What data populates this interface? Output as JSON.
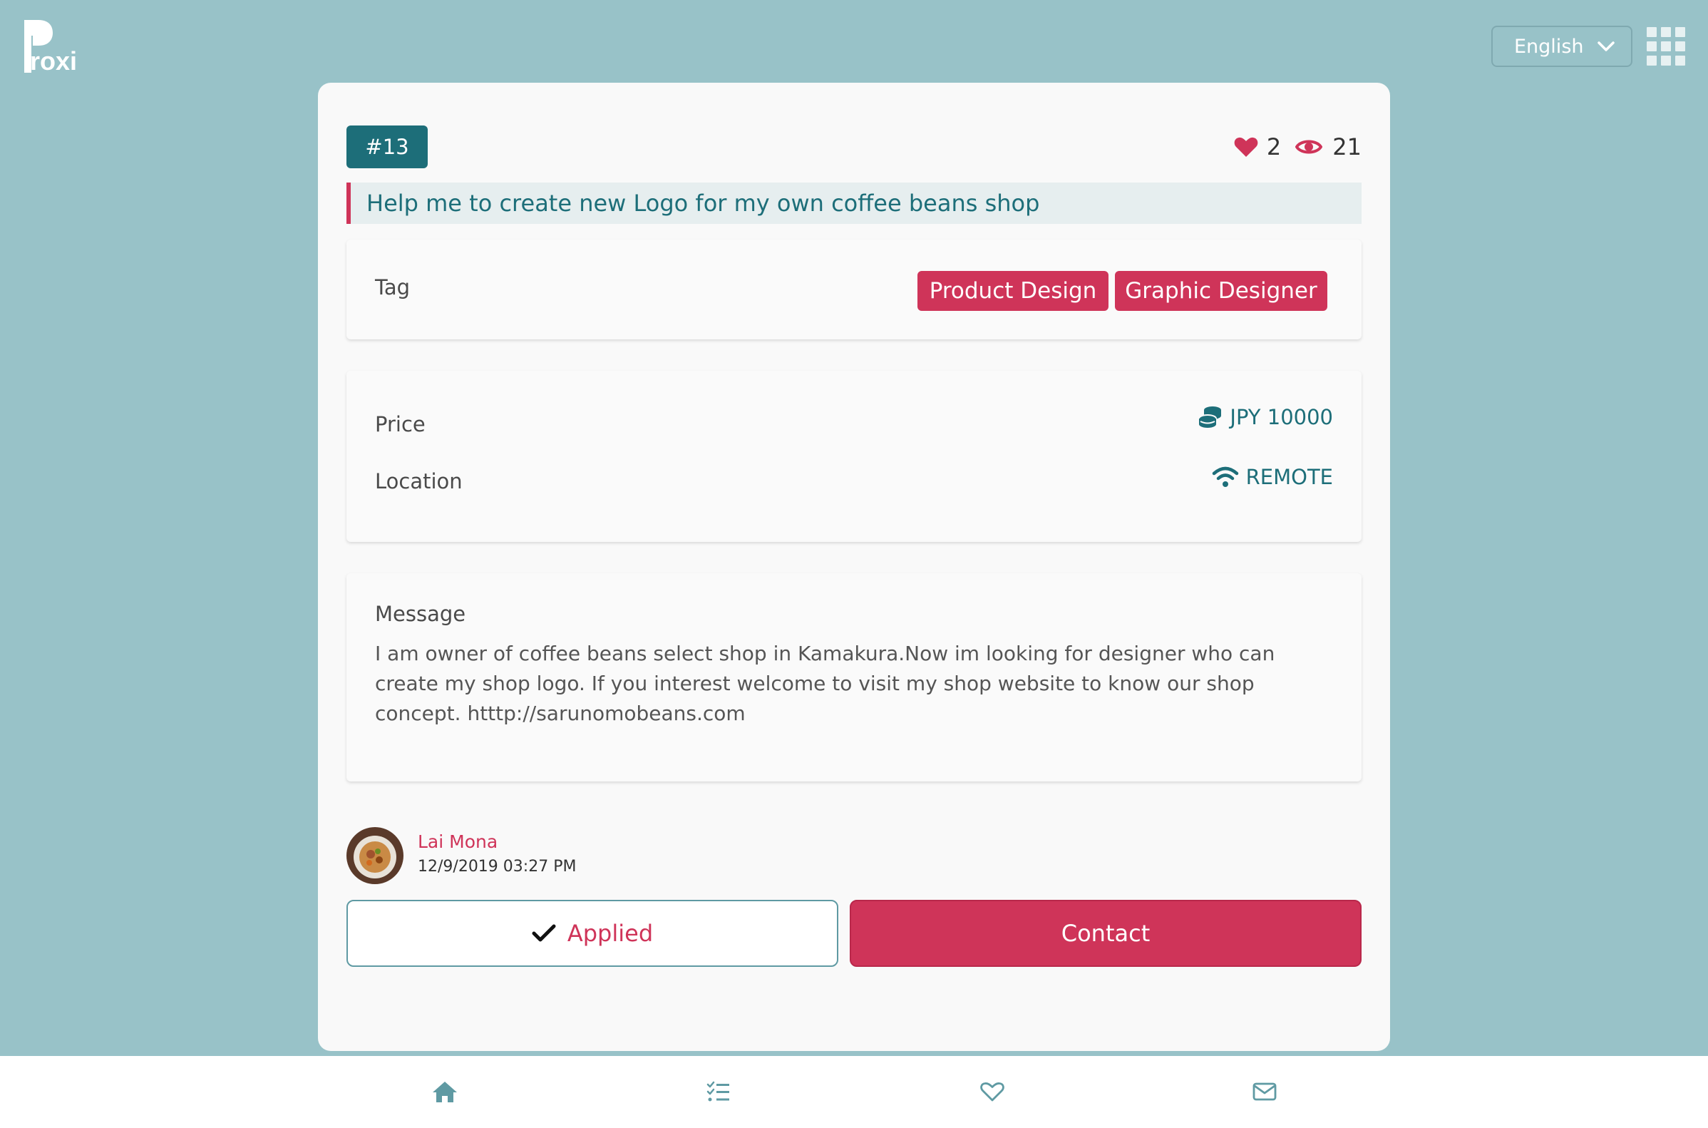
{
  "header": {
    "logo_text": "roxi",
    "language": "English"
  },
  "post": {
    "id_label": "#13",
    "likes": "2",
    "views": "21",
    "title": "Help me to create new Logo for my own coffee beans shop",
    "tag_label": "Tag",
    "tags": [
      "Product Design",
      "Graphic Designer"
    ],
    "price_label": "Price",
    "price_value": "JPY 10000",
    "location_label": "Location",
    "location_value": "REMOTE",
    "message_heading": "Message",
    "message_body": "I am owner of coffee beans select shop in Kamakura.Now im looking for designer who can create my shop logo. If you interest welcome to visit my shop website to know our shop concept. htttp://sarunomobeans.com"
  },
  "author": {
    "name": "Lai Mona",
    "date": "12/9/2019 03:27 PM"
  },
  "actions": {
    "applied_label": "Applied",
    "contact_label": "Contact"
  },
  "bottom_nav": {
    "items": [
      {
        "icon": "home-icon"
      },
      {
        "icon": "task-list-icon"
      },
      {
        "icon": "heart-outline-icon"
      },
      {
        "icon": "envelope-icon"
      }
    ]
  },
  "colors": {
    "background": "#98c2c8",
    "teal": "#1d6e79",
    "accent": "#cf3459",
    "card": "#f9f9f9"
  }
}
